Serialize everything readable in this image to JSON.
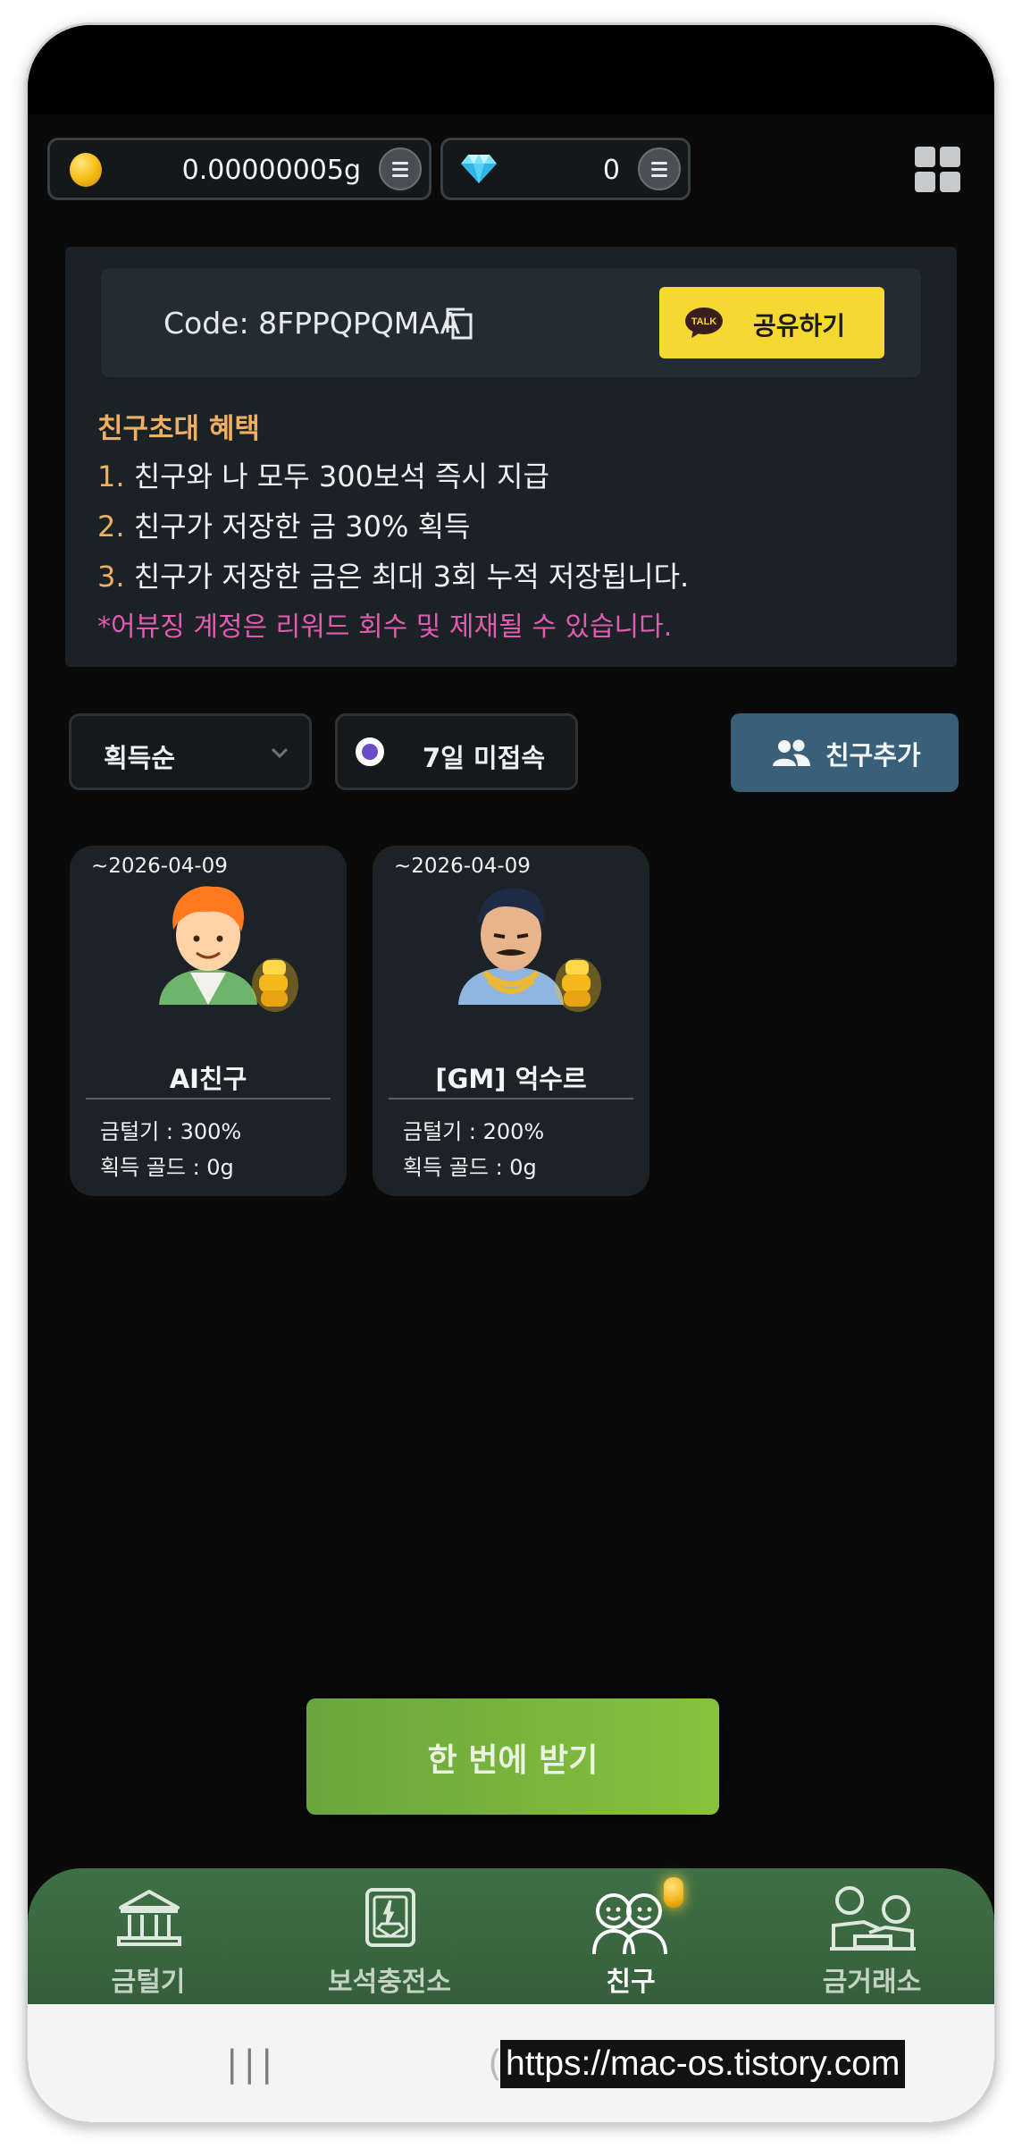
{
  "currency": {
    "gold_amount": "0.00000005g",
    "gem_amount": "0",
    "gold_icon": "gold-coin-icon",
    "gem_icon": "diamond-icon"
  },
  "invite": {
    "code_text": "Code: 8FPPQPQMAA",
    "share_label": "공유하기",
    "share_badge": "TALK",
    "benefit_title": "친구초대 혜택",
    "benefits": [
      {
        "num": "1.",
        "text": "친구와 나 모두 300보석 즉시 지급"
      },
      {
        "num": "2.",
        "text": "친구가 저장한 금 30% 획득"
      },
      {
        "num": "3.",
        "text": "친구가 저장한 금은 최대 3회 누적 저장됩니다."
      }
    ],
    "warning": "*어뷰징 계정은 리워드 회수 및 제재될 수 있습니다."
  },
  "filters": {
    "sort_selected": "획득순",
    "inactive_toggle": "7일 미접속",
    "add_friend": "친구추가"
  },
  "friends": [
    {
      "date": "~2026-04-09",
      "name": "AI친구",
      "stat1": "금털기 : 300%",
      "stat2": "획득 골드 : 0g"
    },
    {
      "date": "~2026-04-09",
      "name": "[GM] 억수르",
      "stat1": "금털기 : 200%",
      "stat2": "획득 골드 : 0g"
    }
  ],
  "claim_label": "한 번에 받기",
  "nav": {
    "items": [
      {
        "label": "금털기",
        "icon": "bank-icon"
      },
      {
        "label": "보석충전소",
        "icon": "gem-charger-icon"
      },
      {
        "label": "친구",
        "icon": "friends-icon"
      },
      {
        "label": "금거래소",
        "icon": "exchange-icon"
      }
    ],
    "active": "친구"
  },
  "system": {
    "recents": "|||",
    "watermark": "https://mac-os.tistory.com",
    "watermark_prefix": "("
  },
  "colors": {
    "background": "#0a0a0a",
    "accent_orange": "#f0b062",
    "warning_pink": "#e35bb1",
    "kakao_yellow": "#f5d832",
    "claim_green": "#7ab43c",
    "nav_green": "#3f7045",
    "add_button": "#3a6079"
  }
}
